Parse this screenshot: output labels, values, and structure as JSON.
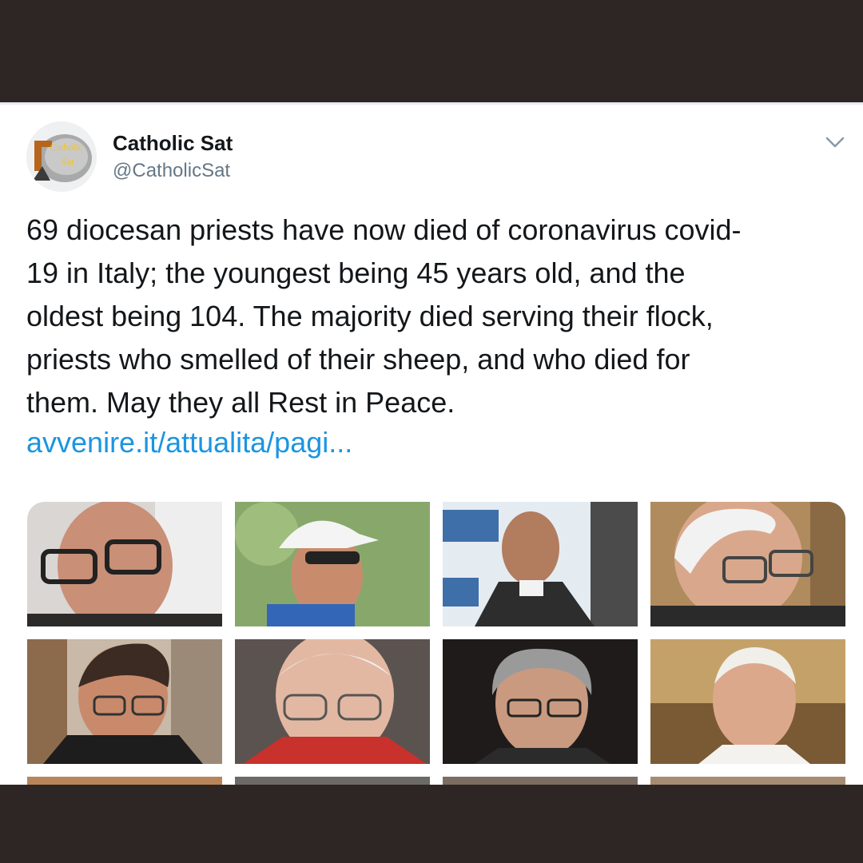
{
  "tweet": {
    "display_name": "Catholic Sat",
    "handle": "@CatholicSat",
    "avatar": {
      "logo_text": [
        "Catholic",
        "Sat"
      ],
      "icon": "satellite-dish-logo"
    },
    "text": "69 diocesan priests have now died of coronavirus covid-\n19 in Italy; the youngest being 45 years old, and the\noldest being 104. The majority died serving their flock,\npriests who smelled of their sheep, and who died for\nthem. May they all Rest in Peace.",
    "link": "avvenire.it/attualita/pagi...",
    "menu_icon": "chevron-down-icon"
  },
  "media": {
    "photos": [
      {
        "name": "priest-photo-1"
      },
      {
        "name": "priest-photo-2"
      },
      {
        "name": "priest-photo-3"
      },
      {
        "name": "priest-photo-4"
      },
      {
        "name": "priest-photo-5"
      },
      {
        "name": "priest-photo-6"
      },
      {
        "name": "priest-photo-7"
      },
      {
        "name": "priest-photo-8"
      }
    ]
  },
  "colors": {
    "frame": "#2e2525",
    "link": "#1b95e0",
    "text": "#14171a",
    "secondary": "#657786"
  }
}
